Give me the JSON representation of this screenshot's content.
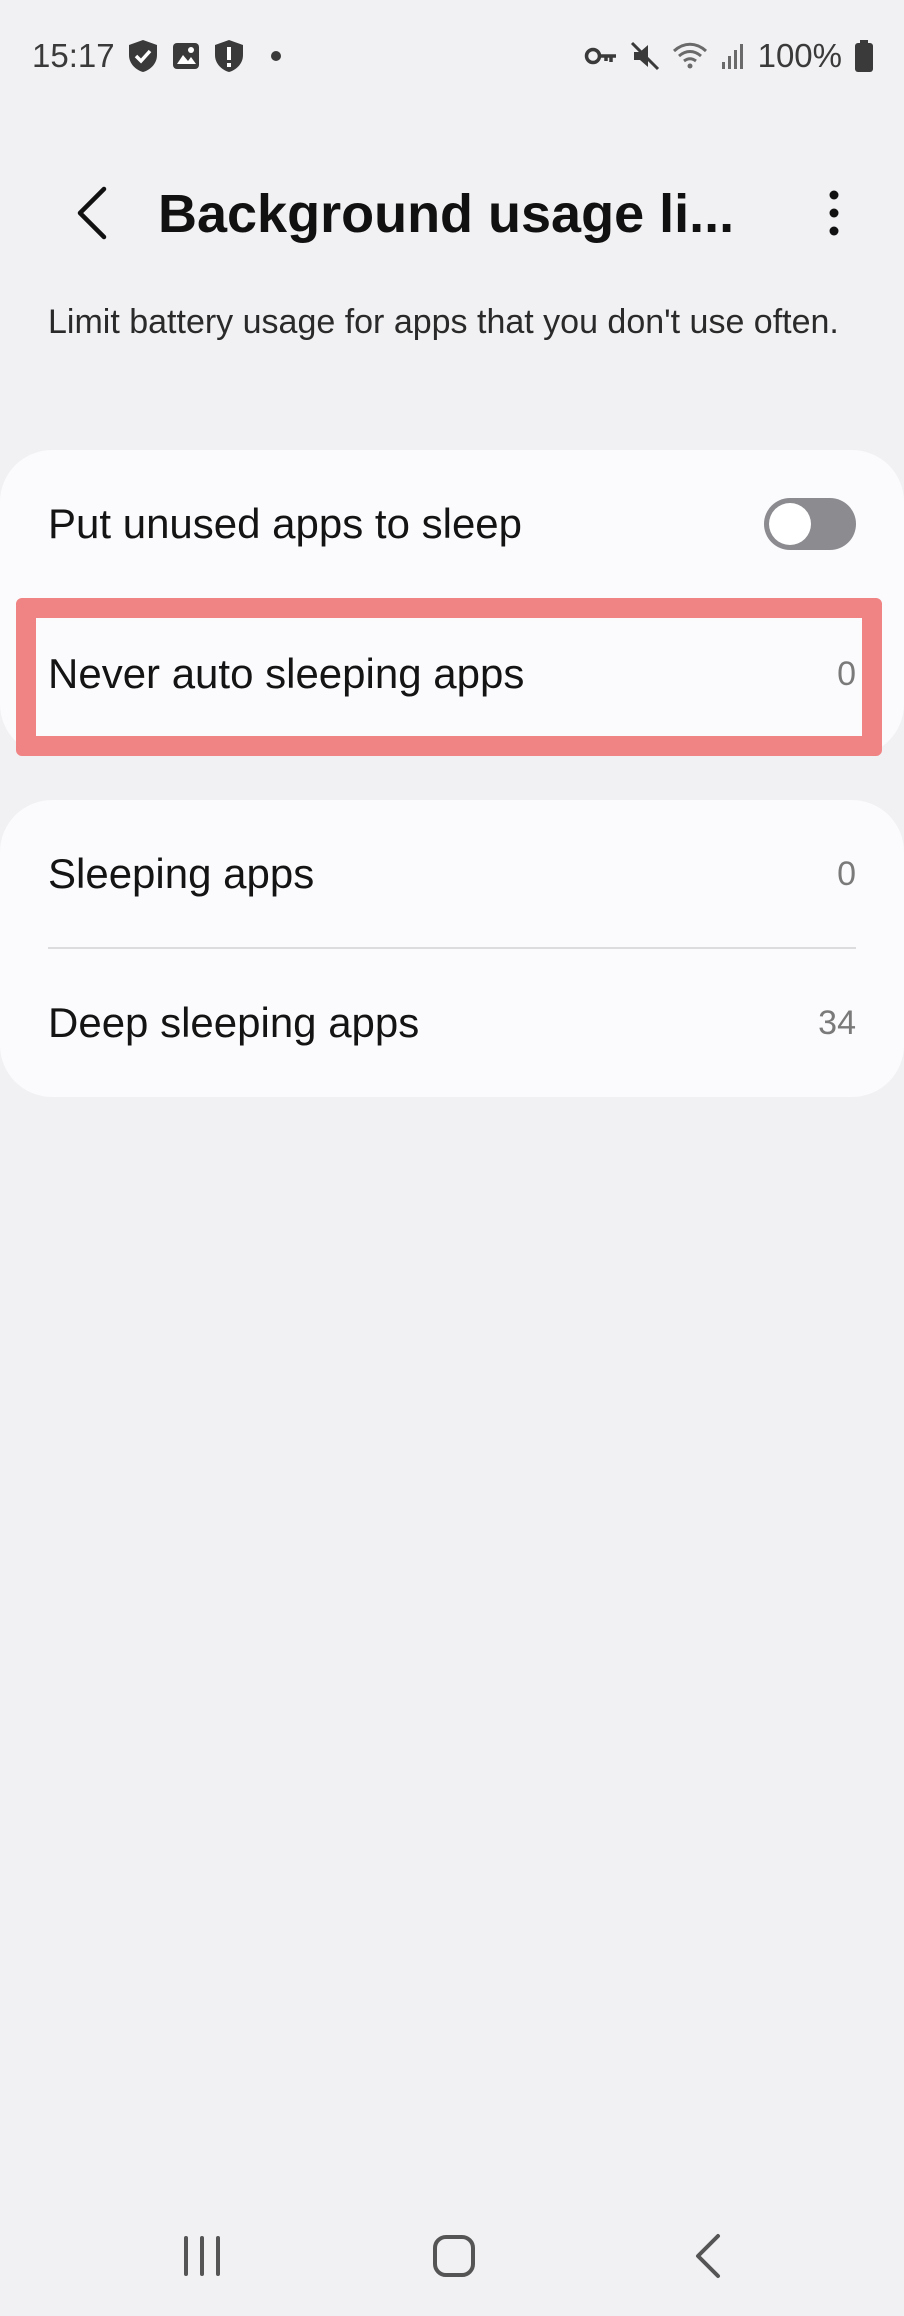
{
  "status_bar": {
    "time": "15:17",
    "battery_text": "100%",
    "left_icons": [
      "shield-check-icon",
      "gallery-icon",
      "shield-alert-icon",
      "notification-dot-icon"
    ],
    "right_icons": [
      "vpn-key-icon",
      "mute-icon",
      "wifi-icon",
      "signal-icon",
      "battery-icon"
    ]
  },
  "header": {
    "title": "Background usage li...",
    "back_icon": "back-arrow-icon",
    "more_icon": "more-vertical-icon"
  },
  "description": "Limit battery usage for apps that you don't use often.",
  "sleep_settings": {
    "put_unused_label": "Put unused apps to sleep",
    "put_unused_enabled": false,
    "never_auto_label": "Never auto sleeping apps",
    "never_auto_count": "0"
  },
  "sleep_lists": {
    "sleeping_label": "Sleeping apps",
    "sleeping_count": "0",
    "deep_sleeping_label": "Deep sleeping apps",
    "deep_sleeping_count": "34"
  },
  "nav_bar": {
    "recents_icon": "recents-icon",
    "home_icon": "home-icon",
    "back_icon": "nav-back-icon"
  },
  "colors": {
    "background": "#f1f1f3",
    "card": "#fbfbfd",
    "highlight": "#f08383",
    "toggle_off": "#8b8b90"
  }
}
